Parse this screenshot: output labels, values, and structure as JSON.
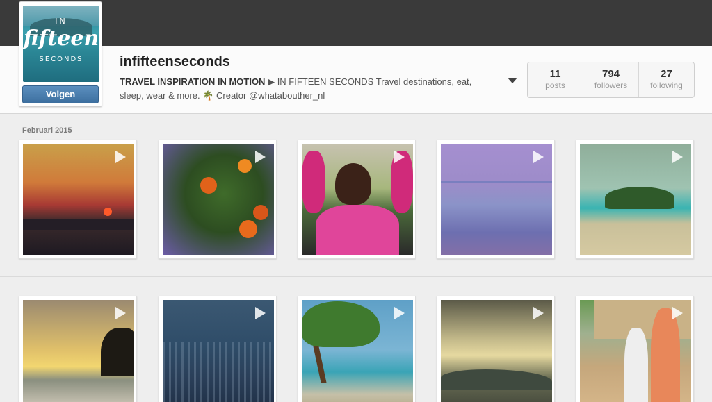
{
  "profile": {
    "avatar": {
      "line1": "IN",
      "line2": "fifteen",
      "line3": "SECONDS"
    },
    "follow_label": "Volgen",
    "username": "infifteenseconds",
    "bio_strong": "TRAVEL INSPIRATION IN MOTION",
    "bio_arrow": "▶",
    "bio_text": " IN FIFTEEN SECONDS Travel destinations, eat, sleep, wear & more. ",
    "bio_emoji": "🌴",
    "bio_text2": " Creator @whatabouther_nl"
  },
  "stats": [
    {
      "value": "11",
      "label": "posts"
    },
    {
      "value": "794",
      "label": "followers"
    },
    {
      "value": "27",
      "label": "following"
    }
  ],
  "feed": {
    "month_label": "Februari 2015",
    "items": [
      {
        "subject": "sunset",
        "type": "video"
      },
      {
        "subject": "oranges",
        "type": "video"
      },
      {
        "subject": "carnival-dancer",
        "type": "video"
      },
      {
        "subject": "sea",
        "type": "video"
      },
      {
        "subject": "island",
        "type": "video"
      },
      {
        "subject": "beach-sunset",
        "type": "video"
      },
      {
        "subject": "aerial-city",
        "type": "video"
      },
      {
        "subject": "divi-tree-beach",
        "type": "video"
      },
      {
        "subject": "cloudy-sky",
        "type": "video"
      },
      {
        "subject": "children",
        "type": "video"
      }
    ]
  },
  "icons": {
    "play": "play-icon",
    "dropdown": "chevron-down-icon"
  },
  "colors": {
    "topbar": "#3a3a3a",
    "follow_button": "#4a7fb0"
  }
}
